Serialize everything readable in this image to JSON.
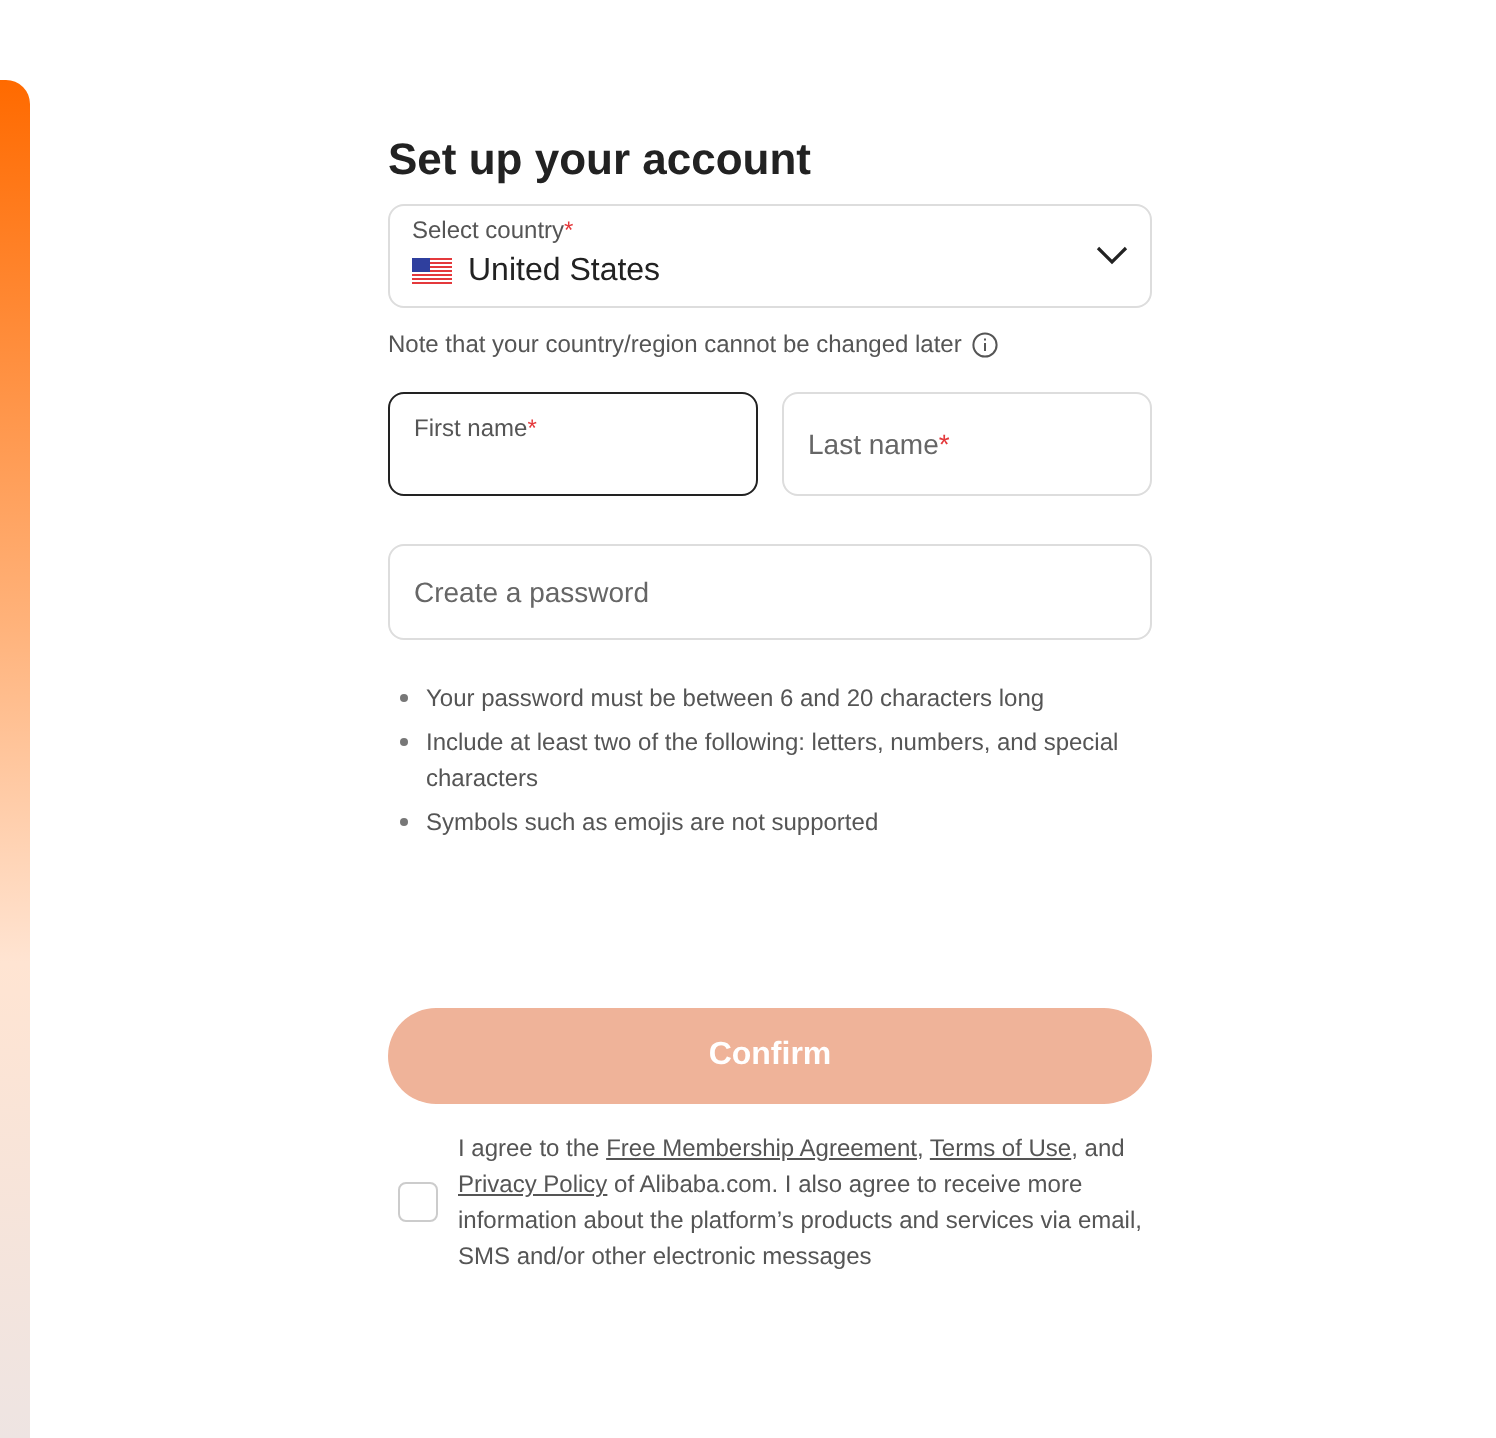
{
  "title": "Set up your account",
  "country": {
    "label": "Select country",
    "required_mark": "*",
    "value": "United States"
  },
  "country_note": "Note that your country/region cannot be changed later",
  "fields": [
    {
      "label": "First name",
      "required_mark": "*",
      "focused": true
    },
    {
      "label": "Last name",
      "required_mark": "*",
      "focused": false
    }
  ],
  "password": {
    "placeholder": "Create a password"
  },
  "rules": [
    "Your password must be between 6 and 20 characters long",
    "Include at least two of the following: letters, numbers, and special characters",
    "Symbols such as emojis are not supported"
  ],
  "confirm": {
    "label": "Confirm",
    "disabled": true
  },
  "agreement": {
    "checked": false,
    "parts": [
      {
        "kind": "text",
        "text": "I agree to the "
      },
      {
        "kind": "link",
        "text": "Free Membership Agreement"
      },
      {
        "kind": "text",
        "text": ", "
      },
      {
        "kind": "link",
        "text": "Terms of Use"
      },
      {
        "kind": "text",
        "text": ", and "
      },
      {
        "kind": "link",
        "text": "Privacy Policy"
      },
      {
        "kind": "text",
        "text": " of Alibaba.com. I also agree to receive more information about the platform’s products and services via email, SMS and/or other electronic messages"
      }
    ]
  }
}
